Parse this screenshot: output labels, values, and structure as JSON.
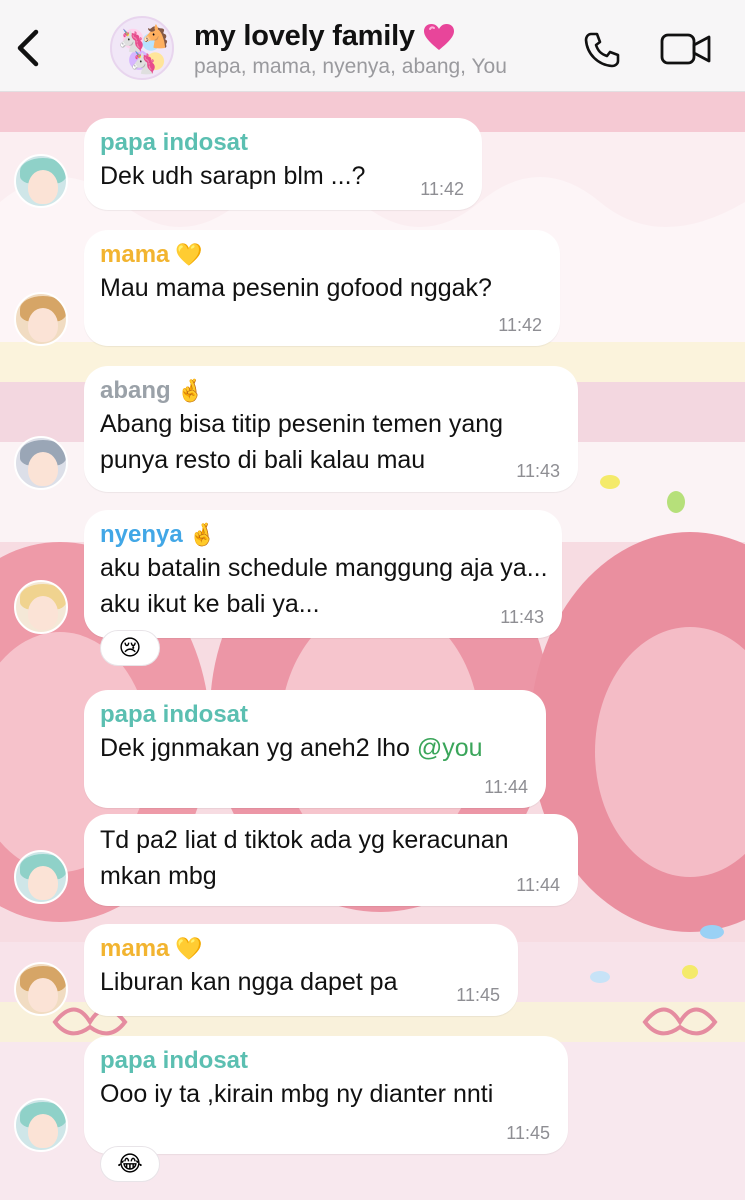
{
  "header": {
    "title": "my lovely family",
    "members": "papa, mama, nyenya, abang, You",
    "icons": [
      "chevron-left-icon",
      "group-avatar",
      "pink-heart-icon",
      "phone-icon",
      "video-camera-icon"
    ],
    "accent_heart": "#e8459a"
  },
  "messages": [
    {
      "sender": "papa indosat",
      "emoji": "",
      "text": "Dek udh sarapn blm ...?",
      "time": "11:42"
    },
    {
      "sender": "mama",
      "emoji": "💛",
      "text": "Mau mama pesenin gofood nggak?",
      "time": "11:42"
    },
    {
      "sender": "abang",
      "emoji": "🤞",
      "text": "Abang bisa titip pesenin temen yang punya resto di bali kalau mau",
      "time": "11:43"
    },
    {
      "sender": "nyenya",
      "emoji": "🤞",
      "text": "aku batalin schedule manggung aja ya... aku ikut ke bali ya...",
      "time": "11:43",
      "reaction": "😢"
    },
    {
      "sender": "papa indosat",
      "emoji": "",
      "text": "Dek jgnmakan yg aneh2 lho ",
      "mention": "@you",
      "time": "11:44"
    },
    {
      "sender": "",
      "emoji": "",
      "text": "Td pa2 liat d tiktok ada yg keracunan mkan mbg",
      "time": "11:44"
    },
    {
      "sender": "mama",
      "emoji": "💛",
      "text": "Liburan kan ngga dapet pa",
      "time": "11:45"
    },
    {
      "sender": "papa indosat",
      "emoji": "",
      "text": "Ooo iy ta ,kirain mbg ny dianter nnti",
      "time": "11:45",
      "reaction": "😂"
    }
  ],
  "colors": {
    "papa": "#5bbfb1",
    "mama": "#f2b430",
    "abang": "#9aa1a8",
    "nyenya": "#42a7e6",
    "mention": "#3aa55a",
    "time": "#8e8e93"
  }
}
